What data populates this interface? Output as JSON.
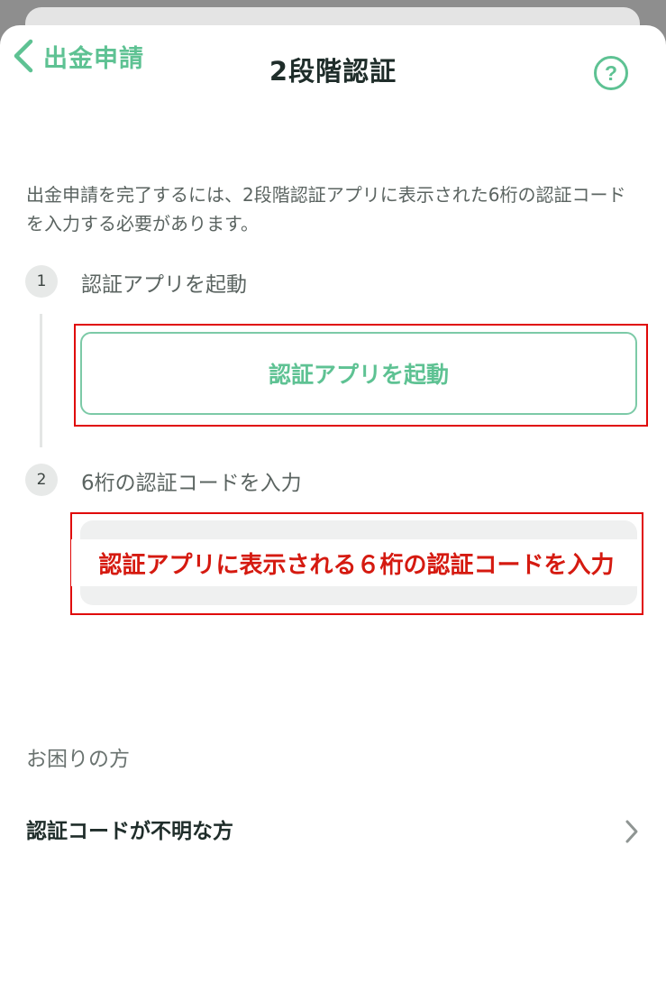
{
  "header": {
    "back_label": "出金申請",
    "title": "2段階認証",
    "help_icon_glyph": "?"
  },
  "description": "出金申請を完了するには、2段階認証アプリに表示された6桁の認証コードを入力する必要があります。",
  "steps": [
    {
      "number": "1",
      "label": "認証アプリを起動",
      "button_label": "認証アプリを起動"
    },
    {
      "number": "2",
      "label": "6桁の認証コードを入力",
      "input_value": ""
    }
  ],
  "annotation": {
    "text": "認証アプリに表示される６桁の認証コードを入力"
  },
  "help_section": {
    "heading": "お困りの方",
    "row_label": "認証コードが不明な方"
  },
  "colors": {
    "accent": "#5ec293",
    "annotation_red": "#e00808",
    "text_dark": "#1f2d2a",
    "text_muted": "#5b6461"
  }
}
